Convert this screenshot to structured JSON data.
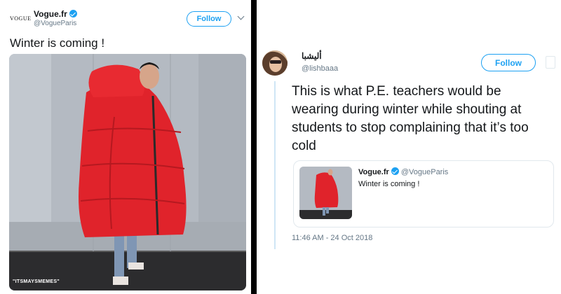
{
  "left_tweet": {
    "logo_text": "VOGUE",
    "author_name": "Vogue.fr",
    "author_handle": "@VogueParis",
    "follow_label": "Follow",
    "text": "Winter is coming !",
    "watermark": "\"ITSMAYSMEMES\""
  },
  "right_tweet": {
    "author_name": "أليشبا",
    "author_handle": "@lishbaaa",
    "follow_label": "Follow",
    "text": "This is what P.E. teachers would be wearing during winter while shouting at students to stop complaining that it’s too cold",
    "quoted": {
      "author_name": "Vogue.fr",
      "author_handle": "@VogueParis",
      "text": "Winter is coming !"
    },
    "timestamp": "11:46 AM - 24 Oct 2018"
  },
  "colors": {
    "twitter_blue": "#1da1f2",
    "coat_red": "#e0232b",
    "wall_gray": "#b6bcc4",
    "divider": "#000000"
  },
  "icons": [
    "verified-badge-icon",
    "chevron-down-icon",
    "more-options-icon"
  ]
}
